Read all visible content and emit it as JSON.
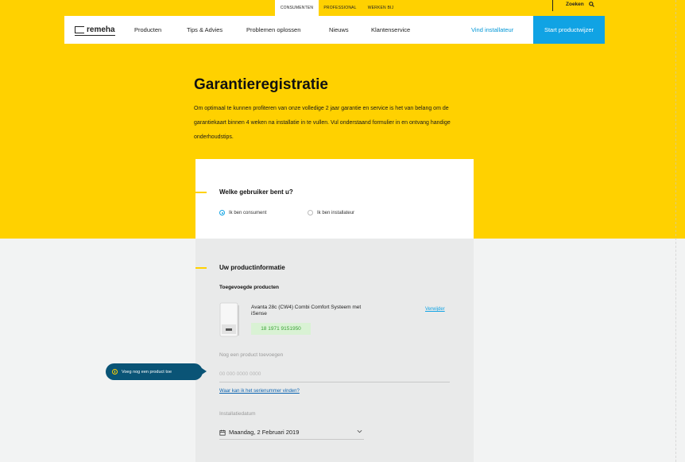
{
  "meta_nav": {
    "tabs": [
      {
        "label": "CONSUMENTEN",
        "active": true
      },
      {
        "label": "PROFESSIONAL",
        "active": false
      },
      {
        "label": "WERKEN BIJ",
        "active": false
      }
    ],
    "search_label": "Zoeken"
  },
  "nav": {
    "logo_text": "remeha",
    "items": [
      "Producten",
      "Tips & Advies",
      "Problemen oplossen",
      "Nieuws",
      "Klantenservice"
    ],
    "find_installer": "Vind installateur",
    "cta": "Start productwijzer"
  },
  "hero": {
    "title": "Garantieregistratie",
    "intro": "Om optimaal te kunnen profiteren van onze volledige 2 jaar garantie en service is het van belang om de garantiekaart binnen 4 weken na installatie in te vullen. Vul onderstaand formulier in en ontvang handige onderhoudstips."
  },
  "user_section": {
    "title": "Welke gebruiker bent u?",
    "options": [
      {
        "label": "Ik ben consument",
        "selected": true
      },
      {
        "label": "Ik ben installateur",
        "selected": false
      }
    ]
  },
  "product_section": {
    "title": "Uw productinformatie",
    "added_title": "Toegevoegde producten",
    "product": {
      "name": "Avanta 28c (CW4) Combi Comfort Systeem met iSense",
      "serial": "18 1971 9151950",
      "remove_label": "Verwijder"
    },
    "add_label": "Nog een product toevoegen",
    "serial_placeholder": "00 000 0000 0000",
    "help_link": "Waar kan ik het serienummer vinden?",
    "date_label": "Installatiedatum",
    "date_value": "Maandag, 2 Februari 2019"
  },
  "tooltip": {
    "text": "Voeg nog een product toe"
  },
  "colors": {
    "brand_yellow": "#ffd100",
    "accent_blue": "#10a3e4",
    "tooltip_bg": "#0a5476",
    "serial_green": "#3aa236"
  },
  "icons": [
    "search-icon",
    "info-icon",
    "calendar-icon",
    "chevron-down-icon"
  ]
}
